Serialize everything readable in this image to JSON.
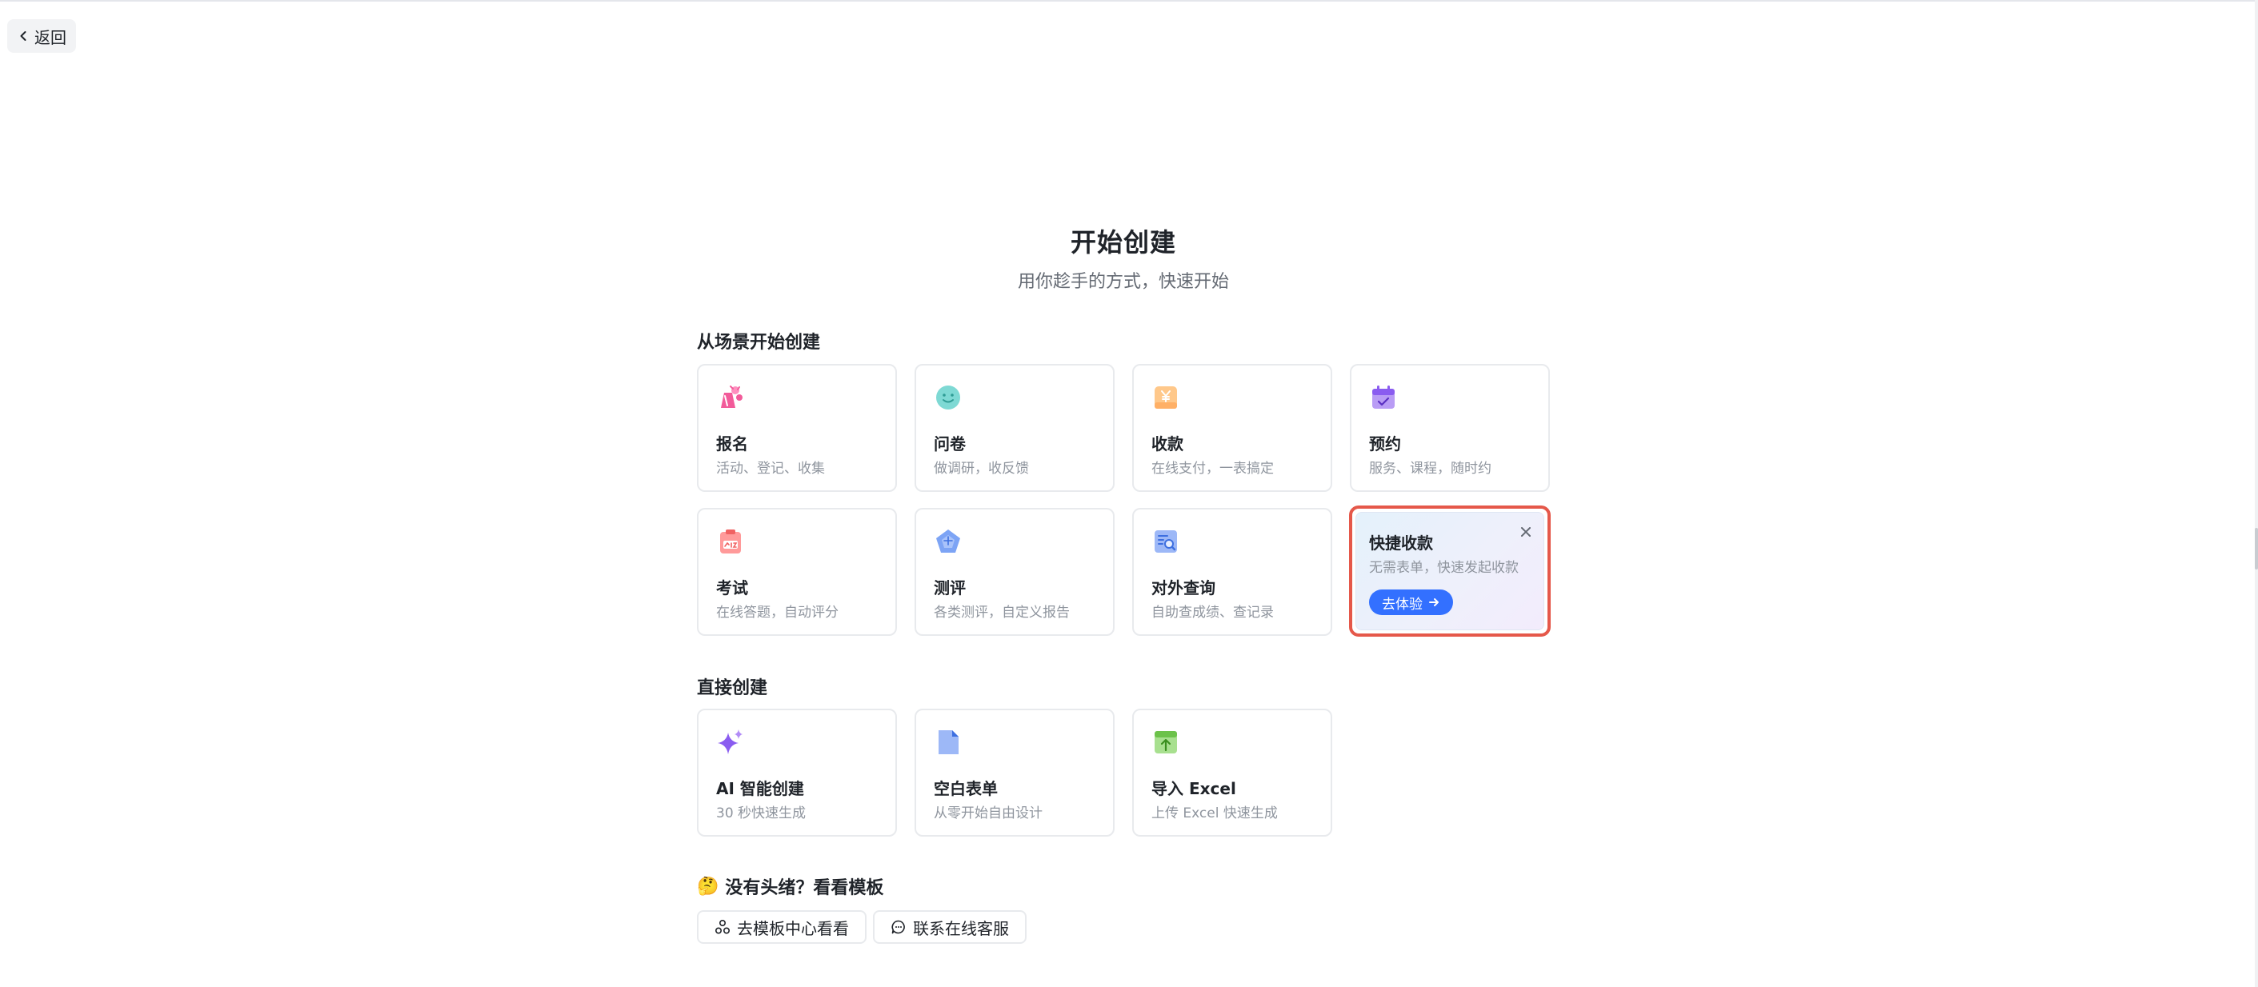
{
  "nav": {
    "back_label": "返回"
  },
  "header": {
    "title": "开始创建",
    "subtitle": "用你趁手的方式，快速开始"
  },
  "scene_section": {
    "title": "从场景开始创建",
    "cards": [
      {
        "title": "报名",
        "desc": "活动、登记、收集",
        "icon": "registration-icon"
      },
      {
        "title": "问卷",
        "desc": "做调研，收反馈",
        "icon": "smiley-icon"
      },
      {
        "title": "收款",
        "desc": "在线支付，一表搞定",
        "icon": "yuan-icon"
      },
      {
        "title": "预约",
        "desc": "服务、课程，随时约",
        "icon": "calendar-icon"
      },
      {
        "title": "考试",
        "desc": "在线答题，自动评分",
        "icon": "exam-score-icon"
      },
      {
        "title": "测评",
        "desc": "各类测评，自定义报告",
        "icon": "pentagon-icon"
      },
      {
        "title": "对外查询",
        "desc": "自助查成绩、查记录",
        "icon": "search-document-icon"
      }
    ],
    "promo": {
      "title": "快捷收款",
      "desc": "无需表单，快速发起收款",
      "button": "去体验"
    }
  },
  "direct_section": {
    "title": "直接创建",
    "cards": [
      {
        "title": "AI 智能创建",
        "desc": "30 秒快速生成",
        "icon": "sparkle-icon"
      },
      {
        "title": "空白表单",
        "desc": "从零开始自由设计",
        "icon": "blank-document-icon"
      },
      {
        "title": "导入 Excel",
        "desc": "上传 Excel 快速生成",
        "icon": "upload-excel-icon"
      }
    ]
  },
  "template_section": {
    "emoji": "🤔",
    "title": "没有头绪？看看模板",
    "template_link": "去模板中心看看",
    "support_link": "联系在线客服"
  },
  "colors": {
    "accent": "#3370ff",
    "highlight_border": "#e5584a"
  }
}
